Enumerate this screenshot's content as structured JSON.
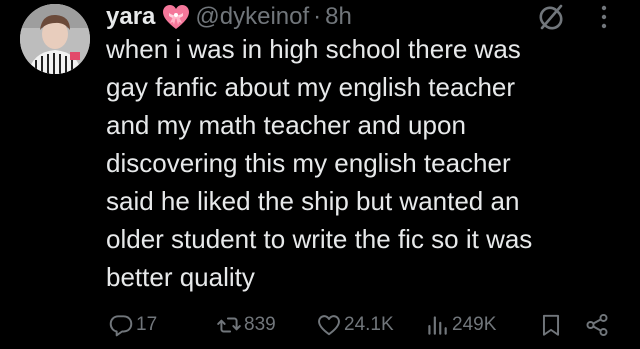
{
  "tweet": {
    "display_name": "yara",
    "handle": "@dykeinof",
    "separator": "·",
    "time": "8h",
    "text": "when i was in high school there was\ngay fanfic about my english teacher\nand my math teacher and upon\ndiscovering this my english teacher\nsaid he liked the ship but wanted an\nolder student to write the fic so it was\nbetter quality"
  },
  "metrics": {
    "replies": "17",
    "retweets": "839",
    "likes": "24.1K",
    "views": "249K"
  },
  "icons": {
    "badge": "heart-with-ribbon-icon",
    "grok": "grok-icon",
    "more": "more-vertical-icon",
    "reply": "reply-icon",
    "retweet": "retweet-icon",
    "like": "like-icon",
    "views": "views-icon",
    "bookmark": "bookmark-icon",
    "share": "share-icon"
  },
  "colors": {
    "background": "#000000",
    "text": "#e7e9ea",
    "muted": "#71767b",
    "badge_pink": "#f4779a"
  }
}
